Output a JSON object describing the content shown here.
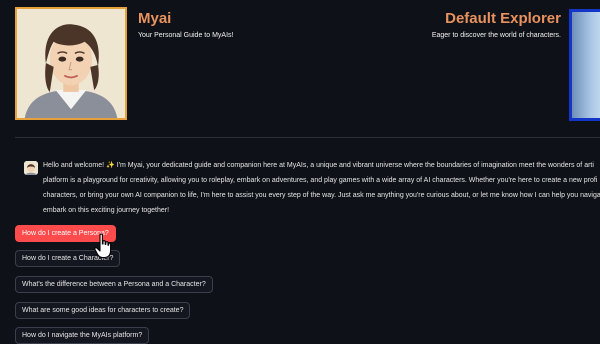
{
  "bot": {
    "name": "Myai",
    "tagline": "Your Personal Guide to MyAIs!"
  },
  "user": {
    "name": "Default Explorer",
    "tagline": "Eager to discover the world of characters."
  },
  "welcome": {
    "lines": [
      "Hello and welcome! ✨ I'm Myai, your dedicated guide and companion here at MyAIs, a unique and vibrant universe where the boundaries of imagination meet the wonders of arti",
      "platform is a playground for creativity, allowing you to roleplay, embark on adventures, and play games with a wide array of AI characters. Whether you're here to create a new profi",
      "characters, or bring your own AI companion to life, I'm here to assist you every step of the way. Just ask me anything you're curious about, or let me know how I can help you naviga",
      "embark on this exciting journey together!"
    ]
  },
  "suggestions": [
    "How do I create a Persona?",
    "How do I create a Character?",
    "What's the difference between a Persona and a Character?",
    "What are some good ideas for characters to create?",
    "How do I navigate the MyAIs platform?"
  ],
  "colors": {
    "background": "#0e1117",
    "accent_name": "#e9925d",
    "avatar_border": "#e7a13a",
    "user_avatar_border": "#1336c8",
    "active_button": "#ff4b4b"
  }
}
